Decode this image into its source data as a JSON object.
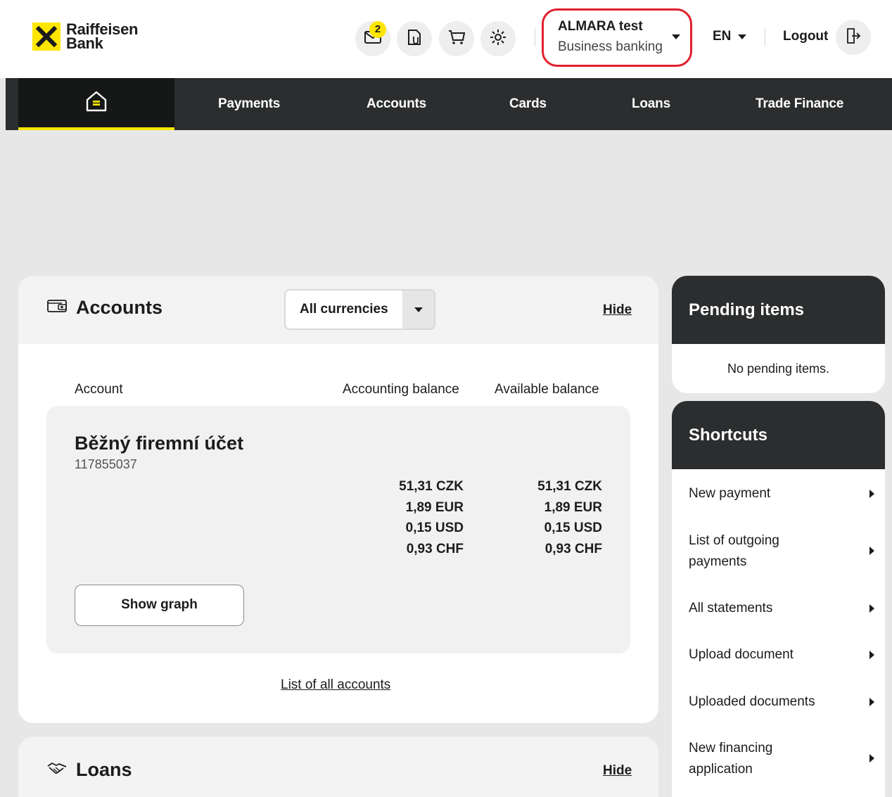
{
  "brand": {
    "line1": "Raiffeisen",
    "line2": "Bank",
    "yellow": "#fee600"
  },
  "header": {
    "messages_badge": "2",
    "icons": [
      "mail-icon",
      "documents-icon",
      "cart-icon",
      "settings-icon",
      "logout-icon"
    ],
    "profile": {
      "name": "ALMARA test",
      "segment": "Business banking"
    },
    "language": "EN",
    "logout_label": "Logout"
  },
  "nav": {
    "home_icon": "home-icon",
    "items": [
      "Payments",
      "Accounts",
      "Cards",
      "Loans",
      "Trade Finance"
    ]
  },
  "accounts_widget": {
    "title": "Accounts",
    "currency_filter": "All currencies",
    "hide_label": "Hide",
    "columns": {
      "account": "Account",
      "accounting": "Accounting balance",
      "available": "Available balance"
    },
    "account": {
      "name": "Běžný firemní účet",
      "number": "117855037",
      "accounting_balances": [
        "51,31 CZK",
        "1,89 EUR",
        "0,15 USD",
        "0,93 CHF"
      ],
      "available_balances": [
        "51,31 CZK",
        "1,89 EUR",
        "0,15 USD",
        "0,93 CHF"
      ]
    },
    "show_graph_label": "Show graph",
    "all_accounts_link": "List of all accounts"
  },
  "loans_widget": {
    "title": "Loans",
    "hide_label": "Hide"
  },
  "pending": {
    "title": "Pending items",
    "empty_text": "No pending items."
  },
  "shortcuts": {
    "title": "Shortcuts",
    "items": [
      "New payment",
      "List of outgoing payments",
      "All statements",
      "Upload document",
      "Uploaded documents",
      "New financing application"
    ]
  },
  "colors": {
    "nav_bg": "#2b2d2e",
    "active_bg": "#161717",
    "highlight_border": "#e0202e",
    "page_bg": "#e6e7e6"
  }
}
